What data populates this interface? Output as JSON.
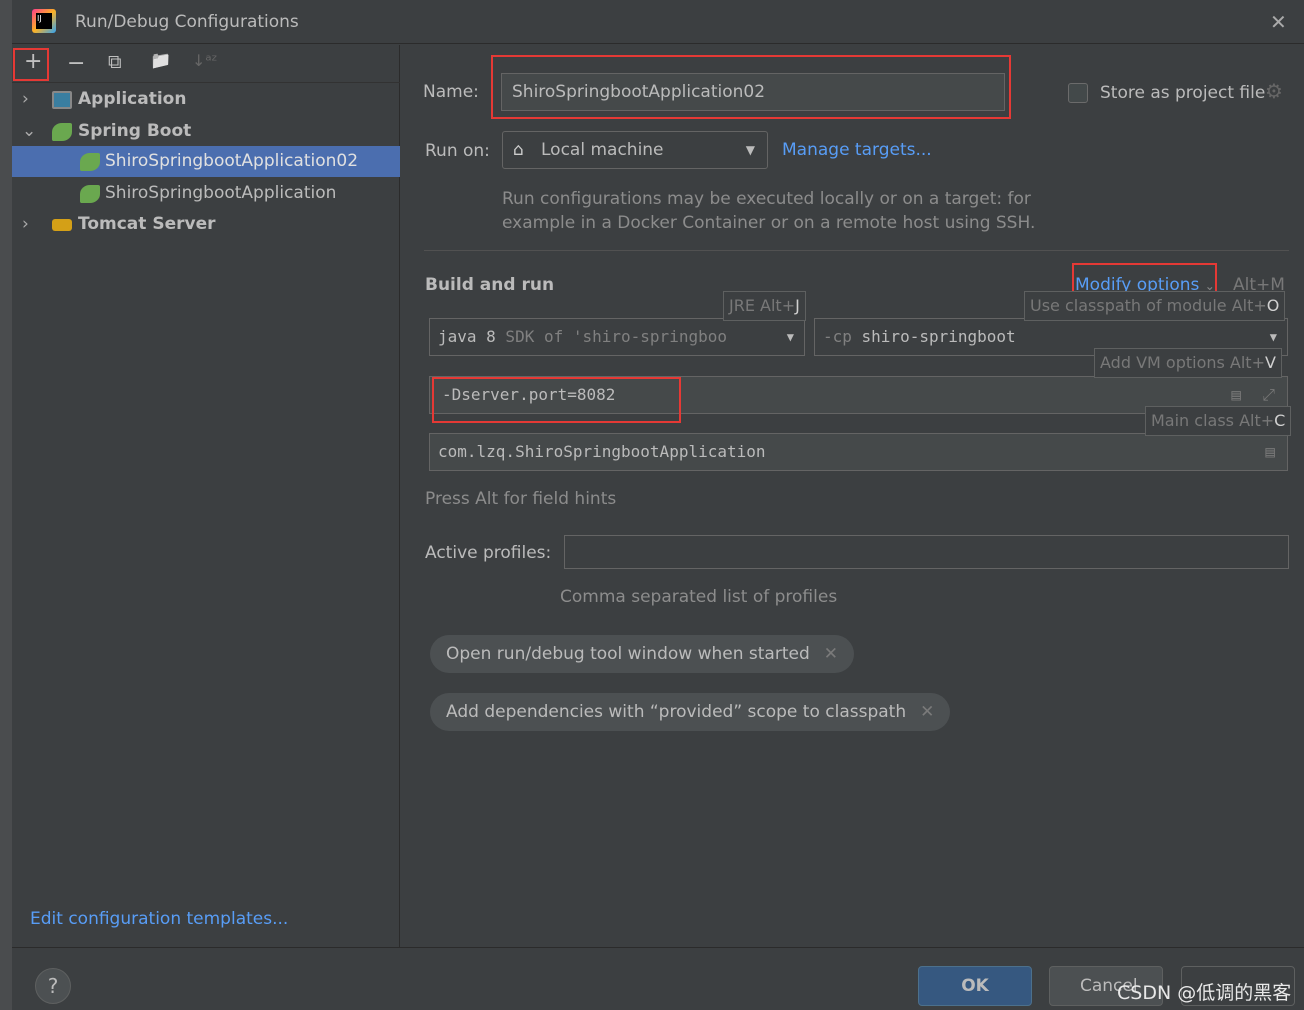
{
  "window": {
    "title": "Run/Debug Configurations",
    "close": "✕"
  },
  "toolbar": {
    "add": "+",
    "remove": "−",
    "copy": "⧉",
    "folder": "📁",
    "sort": "↓ᵃᶻ"
  },
  "tree": [
    {
      "label": "Application",
      "expanded": false
    },
    {
      "label": "Spring Boot",
      "expanded": true
    },
    {
      "label": "ShiroSpringbootApplication02",
      "selected": true
    },
    {
      "label": "ShiroSpringbootApplication"
    },
    {
      "label": "Tomcat Server",
      "expanded": false
    }
  ],
  "edit_templates": "Edit configuration templates...",
  "form": {
    "name_label": "Name:",
    "name_value": "ShiroSpringbootApplication02",
    "store_label": "Store as project file",
    "run_on_label": "Run on:",
    "run_on_value": "Local machine",
    "manage_targets": "Manage targets...",
    "run_on_desc1": "Run configurations may be executed locally or on a target: for",
    "run_on_desc2": "example in a Docker Container or on a remote host using SSH.",
    "build_run": "Build and run",
    "modify_options": "Modify options",
    "modify_shortcut": "Alt+M",
    "jre_value_a": "java 8",
    "jre_value_b": " SDK of 'shiro-springboo",
    "cp_value_a": "-cp ",
    "cp_value_b": "shiro-springboot",
    "vm_options": "-Dserver.port=8082",
    "main_class": "com.lzq.ShiroSpringbootApplication",
    "field_hints": "Press Alt for field hints",
    "active_profiles_label": "Active profiles:",
    "active_profiles_value": "",
    "profiles_hint": "Comma separated list of profiles",
    "chips": [
      "Open run/debug tool window when started",
      "Add dependencies with “provided” scope to classpath"
    ]
  },
  "hints": {
    "jre": "JRE Alt+",
    "jre_key": "J",
    "classpath": "Use classpath of module Alt+",
    "classpath_key": "O",
    "vm": "Add VM options Alt+",
    "vm_key": "V",
    "main": "Main class Alt+",
    "main_key": "C"
  },
  "buttons": {
    "help": "?",
    "ok": "OK",
    "cancel": "Cancel",
    "apply": ""
  },
  "watermark": "CSDN @低调的黑客",
  "colors": {
    "accent": "#589df6",
    "selection": "#4b6eaf",
    "highlight": "#e53935"
  }
}
